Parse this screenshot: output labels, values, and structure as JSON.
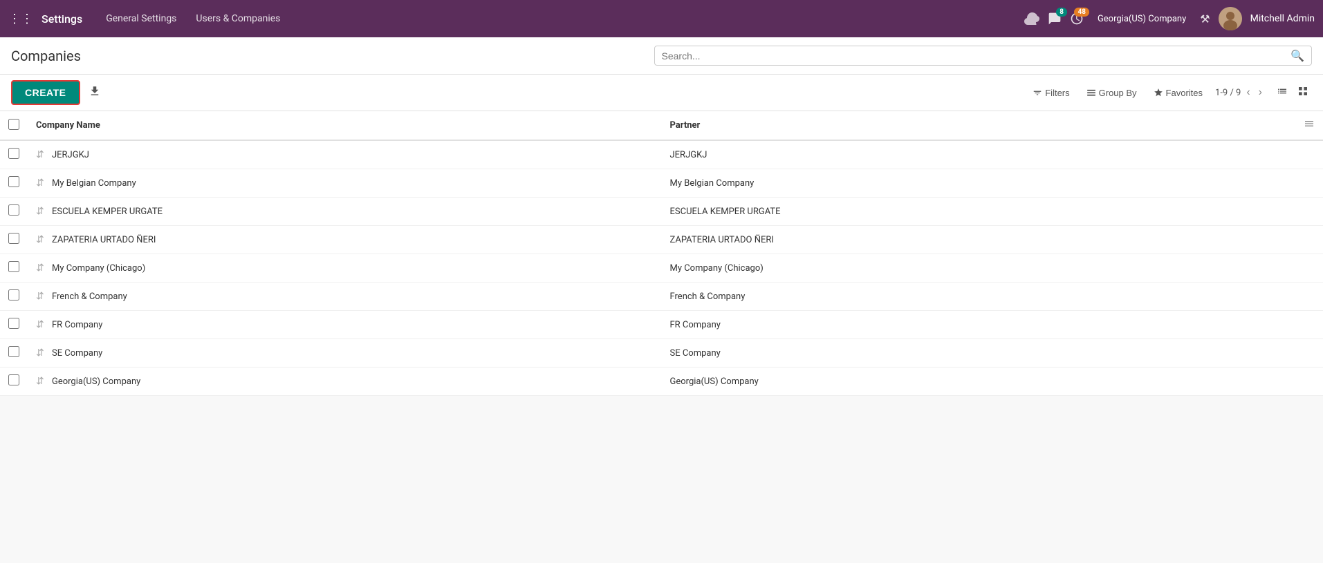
{
  "topNav": {
    "appName": "Settings",
    "menuItems": [
      "General Settings",
      "Users & Companies"
    ],
    "company": "Georgia(US) Company",
    "adminName": "Mitchell Admin",
    "chatBadge": "8",
    "clockBadge": "48"
  },
  "page": {
    "title": "Companies"
  },
  "search": {
    "placeholder": "Search..."
  },
  "toolbar": {
    "createLabel": "CREATE",
    "filtersLabel": "Filters",
    "groupByLabel": "Group By",
    "favoritesLabel": "Favorites",
    "pager": "1-9 / 9"
  },
  "table": {
    "columns": {
      "companyName": "Company Name",
      "partner": "Partner"
    },
    "rows": [
      {
        "name": "JERJGKJ",
        "partner": "JERJGKJ"
      },
      {
        "name": "My Belgian Company",
        "partner": "My Belgian Company"
      },
      {
        "name": "ESCUELA KEMPER URGATE",
        "partner": "ESCUELA KEMPER URGATE"
      },
      {
        "name": "ZAPATERIA URTADO ÑERI",
        "partner": "ZAPATERIA URTADO ÑERI"
      },
      {
        "name": "My Company (Chicago)",
        "partner": "My Company (Chicago)"
      },
      {
        "name": "French & Company",
        "partner": "French & Company"
      },
      {
        "name": "FR Company",
        "partner": "FR Company"
      },
      {
        "name": "SE Company",
        "partner": "SE Company"
      },
      {
        "name": "Georgia(US) Company",
        "partner": "Georgia(US) Company"
      }
    ]
  }
}
